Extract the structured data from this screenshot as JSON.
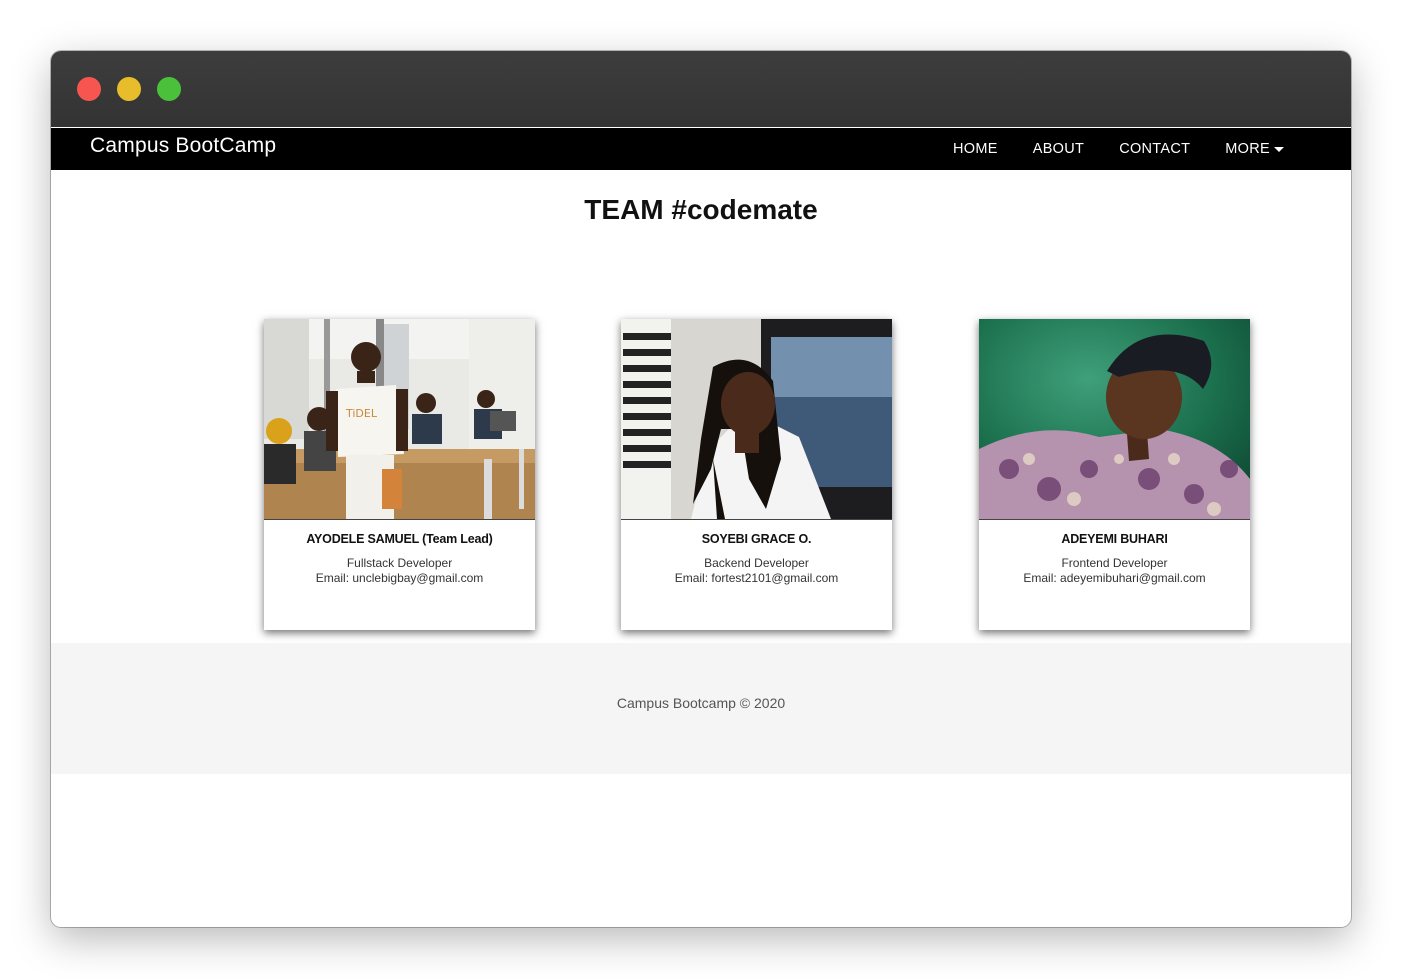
{
  "window": {
    "controls": [
      "close",
      "minimize",
      "maximize"
    ]
  },
  "navbar": {
    "brand": "Campus BootCamp",
    "links": [
      "HOME",
      "ABOUT",
      "CONTACT",
      "MORE"
    ],
    "more_icon": "caret-down-icon"
  },
  "main": {
    "title": "TEAM #codemate",
    "members": [
      {
        "name": "AYODELE SAMUEL (Team Lead)",
        "role": "Fullstack Developer",
        "email": "Email: unclebigbay@gmail.com",
        "photo_icon": "profile-photo"
      },
      {
        "name": "SOYEBI GRACE O.",
        "role": "Backend Developer",
        "email": "Email: fortest2101@gmail.com",
        "photo_icon": "profile-photo"
      },
      {
        "name": "ADEYEMI BUHARI",
        "role": "Frontend Developer",
        "email": "Email: adeyemibuhari@gmail.com",
        "photo_icon": "profile-photo"
      }
    ]
  },
  "footer": {
    "text": "Campus Bootcamp © 2020"
  },
  "colors": {
    "navbar": "#000000",
    "titlebar": "#333333",
    "footer_bg": "#f5f5f5",
    "close": "#f6564f",
    "minimize": "#e8bd2b",
    "maximize": "#4bc13b"
  }
}
